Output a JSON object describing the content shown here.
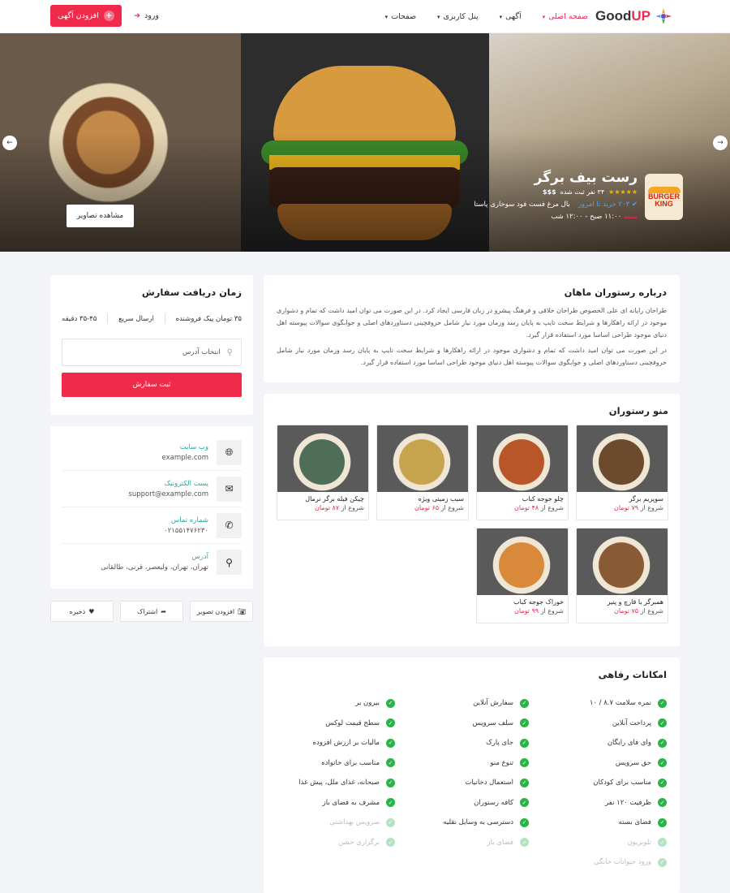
{
  "header": {
    "logo_text_prefix": "Good",
    "logo_text_accent": "UP",
    "nav": [
      {
        "label": "صفحه اصلی",
        "active": true
      },
      {
        "label": "آگهی",
        "active": false
      },
      {
        "label": "پنل کاربری",
        "active": false
      },
      {
        "label": "صفحات",
        "active": false
      }
    ],
    "login_label": "ورود",
    "add_listing_label": "افزودن آگهی",
    "accent_color": "#f02a4b"
  },
  "hero": {
    "view_photos_label": "مشاهده تصاویر",
    "restaurant": {
      "logo_line1": "BURGER",
      "logo_line2": "KING",
      "name": "رست بیف برگر",
      "stars": "★★★★★",
      "rating_count": "۳۴ نفر ثبت شده",
      "price_level": "$$$",
      "bought_today": "۲۰۳ خرید تا امروز",
      "categories": "بال مرغ  فست فود  سوخاری  پاستا",
      "closed_label": "بسته",
      "hours": "۱۱:۰۰ صبح - ۱۲:۰۰ شب"
    }
  },
  "about": {
    "title": "درباره رستوران ماهان",
    "p1": "طراحان رایانه ای علی الخصوص طراحان خلاقی و فرهنگ پیشرو در زبان فارسی ایجاد کرد. در این صورت می توان امید داشت که تمام و دشواری موجود در ارائه راهکارها و شرایط سخت تایپ به پایان رسد وزمان مورد نیاز شامل حروفچینی دستاوردهای اصلی و جوابگوی سوالات پیوسته اهل دنیای موجود طراحی اساسا مورد استفاده قرار گیرد.",
    "p2": "در این صورت می توان امید داشت که تمام و دشواری موجود در ارائه راهکارها و شرایط سخت تایپ به پایان رسد وزمان مورد نیاز شامل حروفچینی دستاوردهای اصلی و جوابگوی سوالات پیوسته اهل دنیای موجود طراحی اساسا مورد استفاده قرار گیرد."
  },
  "menu": {
    "title": "منو رستوران",
    "price_prefix": "شروع از",
    "items": [
      {
        "name": "سوپریم برگر",
        "price": "۷۹ تومان",
        "img_color": "#6b4a2e"
      },
      {
        "name": "چلو جوجه کباب",
        "price": "۴۸ تومان",
        "img_color": "#b8562a"
      },
      {
        "name": "سیب زمینی ویژه",
        "price": "۶۵ تومان",
        "img_color": "#c9a44e"
      },
      {
        "name": "چیکن فیله برگر نرمال",
        "price": "۸۷ تومان",
        "img_color": "#4f6e5a"
      },
      {
        "name": "همبرگر با قارچ و پنیر",
        "price": "۷۵ تومان",
        "img_color": "#8a5a35"
      },
      {
        "name": "خوراک جوجه کباب",
        "price": "۹۹ تومان",
        "img_color": "#d88a3a"
      }
    ]
  },
  "amenities": {
    "title": "امکانات رفاهی",
    "items": [
      {
        "label": "نمره سلامت ۸.۷ / ۱۰",
        "enabled": true
      },
      {
        "label": "سفارش آنلاین",
        "enabled": true
      },
      {
        "label": "بیرون بر",
        "enabled": true
      },
      {
        "label": "پرداخت آنلاین",
        "enabled": true
      },
      {
        "label": "سلف سرویس",
        "enabled": true
      },
      {
        "label": "سطح قیمت لوکس",
        "enabled": true
      },
      {
        "label": "وای فای رایگان",
        "enabled": true
      },
      {
        "label": "جای پارک",
        "enabled": true
      },
      {
        "label": "مالیات بر ارزش افزوده",
        "enabled": true
      },
      {
        "label": "حق سرویس",
        "enabled": true
      },
      {
        "label": "تنوع منو",
        "enabled": true
      },
      {
        "label": "مناسب برای خانواده",
        "enabled": true
      },
      {
        "label": "مناسب برای کودکان",
        "enabled": true
      },
      {
        "label": "استعمال دخانیات",
        "enabled": true
      },
      {
        "label": "صبحانه، غذای ملل، پیش غذا",
        "enabled": true
      },
      {
        "label": "ظرفیت ۱۲۰ نفر",
        "enabled": true
      },
      {
        "label": "کافه رستوران",
        "enabled": true
      },
      {
        "label": "مشرف به فضای باز",
        "enabled": true
      },
      {
        "label": "فضای بسته",
        "enabled": true
      },
      {
        "label": "دسترسی به وسایل نقلیه",
        "enabled": true
      },
      {
        "label": "سرویس بهداشتی",
        "enabled": false
      },
      {
        "label": "تلویزیون",
        "enabled": false
      },
      {
        "label": "فضای باز",
        "enabled": false
      },
      {
        "label": "برگزاری جشن",
        "enabled": false
      },
      {
        "label": "ورود حیوانات خانگی",
        "enabled": false
      }
    ]
  },
  "order": {
    "title": "زمان دریافت سفارش",
    "fee": "۳۵ تومان پیک فروشنده",
    "fast": "ارسال سریع",
    "time": "۳۵-۴۵ دقیقه",
    "address_placeholder": "انتخاب آدرس",
    "submit_label": "ثبت سفارش"
  },
  "contact": {
    "rows": [
      {
        "label": "وب سایت",
        "value": "example.com",
        "icon": "globe-icon"
      },
      {
        "label": "پست الکترونیک",
        "value": "support@example.com",
        "icon": "envelope-icon"
      },
      {
        "label": "شماره تماس",
        "value": "۰۲۱۵۵۱۴۷۶۲۳۰",
        "icon": "phone-icon"
      },
      {
        "label": "آدرس",
        "value": "تهران، تهران، ولیعصر، قرنی، طالقانی",
        "icon": "map-pin-icon"
      }
    ]
  },
  "actions": {
    "add_photo": "افزودن تصویر",
    "share": "اشتراک",
    "save": "ذخیره"
  }
}
